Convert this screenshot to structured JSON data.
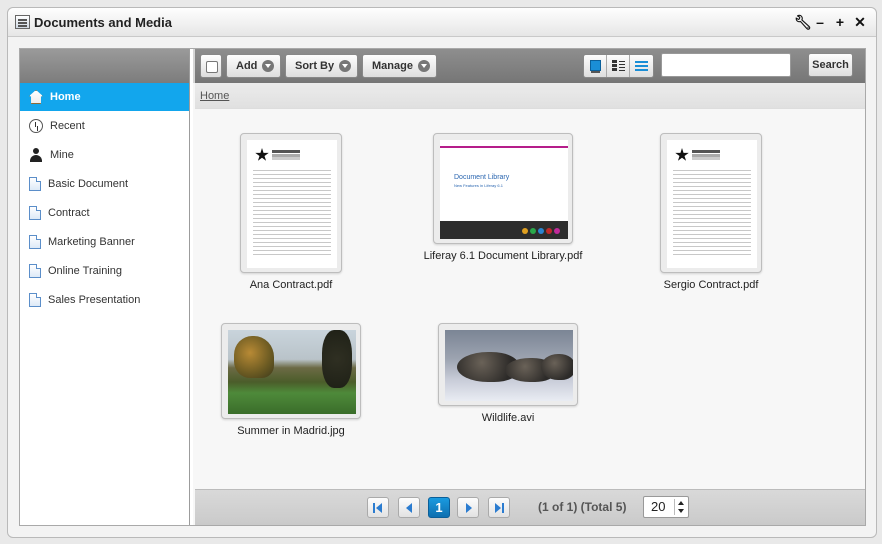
{
  "window": {
    "title": "Documents and Media",
    "controls": [
      "wrench-icon",
      "minimize-icon",
      "maximize-icon",
      "close-icon"
    ]
  },
  "sidebar": {
    "items": [
      {
        "label": "Home",
        "icon": "home-icon",
        "active": true
      },
      {
        "label": "Recent",
        "icon": "clock-icon"
      },
      {
        "label": "Mine",
        "icon": "user-icon"
      },
      {
        "label": "Basic Document",
        "icon": "document-icon"
      },
      {
        "label": "Contract",
        "icon": "document-icon"
      },
      {
        "label": "Marketing Banner",
        "icon": "document-icon"
      },
      {
        "label": "Online Training",
        "icon": "document-icon"
      },
      {
        "label": "Sales Presentation",
        "icon": "document-icon"
      }
    ]
  },
  "toolbar": {
    "add_label": "Add",
    "sort_label": "Sort By",
    "manage_label": "Manage",
    "search_placeholder": "",
    "search_label": "Search"
  },
  "breadcrumb": {
    "home": "Home"
  },
  "entries": [
    {
      "name": "Ana Contract.pdf",
      "type": "pdf"
    },
    {
      "name": "Liferay 6.1 Document Library.pdf",
      "type": "pdf-slide"
    },
    {
      "name": "Sergio Contract.pdf",
      "type": "pdf"
    },
    {
      "name": "Summer in Madrid.jpg",
      "type": "image"
    },
    {
      "name": "Wildlife.avi",
      "type": "video"
    }
  ],
  "slide": {
    "title": "Document Library",
    "subtitle": "New Features in Liferay 6.1"
  },
  "pagination": {
    "current_page": "1",
    "info": "(1 of 1) (Total 5)",
    "page_size": "20"
  },
  "colors": {
    "accent": "#12a6ed",
    "active_page": "#0d6fb0"
  }
}
